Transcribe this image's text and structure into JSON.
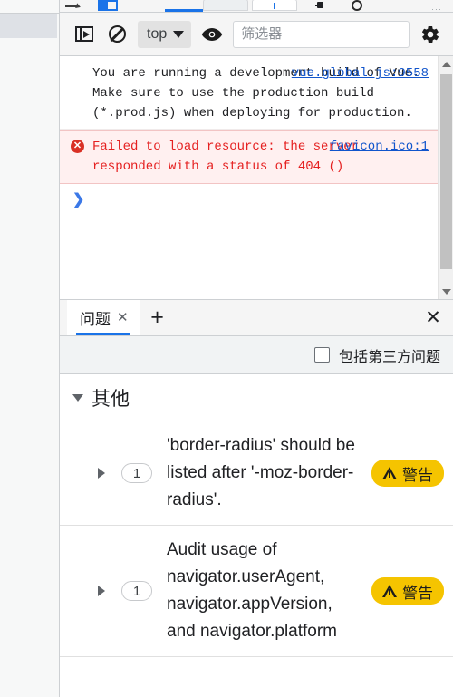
{
  "devtools_tabstrip": {
    "icons": [
      "inspect-element-icon",
      "device-toolbar-icon",
      "warning-count-icon",
      "record-circle-icon",
      "more-options-icon"
    ]
  },
  "console_toolbar": {
    "sidebar_toggle_icon": "sidebar-toggle-icon",
    "clear_console_icon": "clear-console-icon",
    "context_selector": {
      "value": "top",
      "caret_icon": "chevron-down-icon"
    },
    "live_expression_icon": "eye-icon",
    "filter": {
      "value": "",
      "placeholder": "筛选器"
    },
    "settings_icon": "gear-icon"
  },
  "console": {
    "messages": [
      {
        "type": "warning",
        "text": "You are running a development build of Vue.\nMake sure to use the production build (*.prod.js) when deploying for production.",
        "source": "vue.global.js:9558"
      },
      {
        "type": "error",
        "icon": "error-circle-icon",
        "text": "Failed to load resource: the server responded with a status of 404 ()",
        "source": "favicon.ico:1"
      }
    ],
    "prompt_caret": "❯",
    "prompt_value": ""
  },
  "scrollbar": {
    "up_arrow_icon": "scroll-up-arrow-icon",
    "down_arrow_icon": "scroll-down-arrow-icon"
  },
  "issues_panel": {
    "tabs": [
      {
        "label": "问题",
        "close_icon": "close-icon",
        "active": true
      }
    ],
    "add_tab_label": "+",
    "close_panel_label": "✕",
    "third_party_checkbox": {
      "checked": false,
      "label": "包括第三方问题"
    },
    "groups": [
      {
        "title": "其他",
        "expanded": true,
        "issues": [
          {
            "count": "1",
            "title": "'border-radius' should be listed after '-moz-border-radius'.",
            "severity_label": "警告",
            "severity_color": "#f5c400"
          },
          {
            "count": "1",
            "title": "Audit usage of navigator.userAgent, navigator.appVersion, and navigator.platform",
            "severity_label": "警告",
            "severity_color": "#f5c400"
          }
        ]
      }
    ]
  }
}
